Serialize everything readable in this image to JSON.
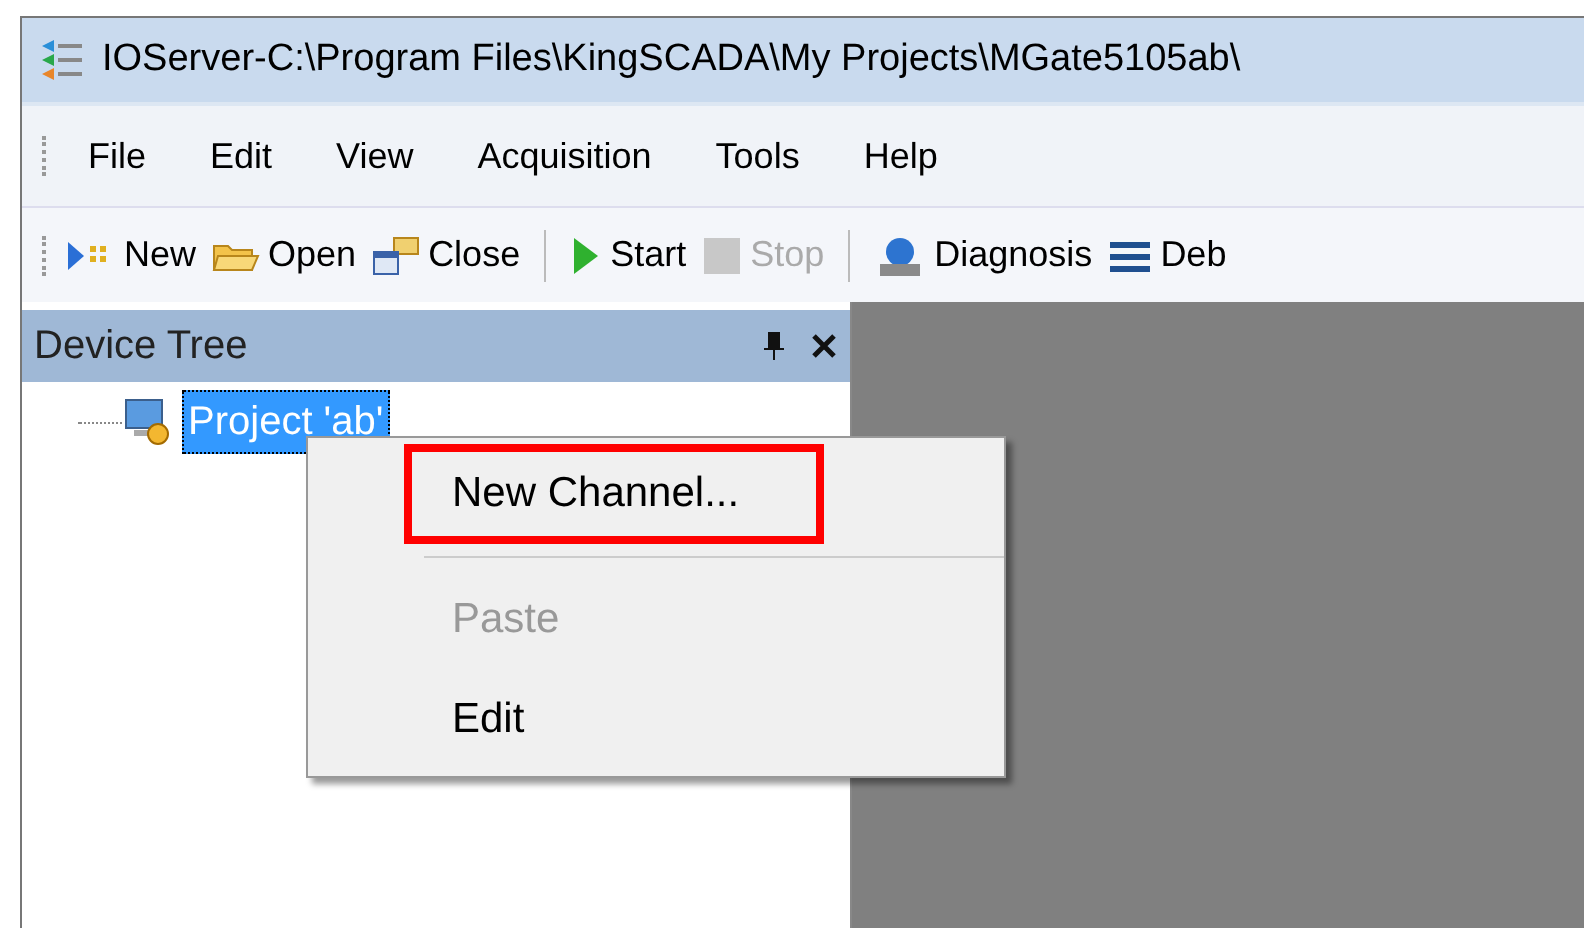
{
  "window": {
    "title": "IOServer-C:\\Program Files\\KingSCADA\\My Projects\\MGate5105ab\\"
  },
  "menu_bar": [
    "File",
    "Edit",
    "View",
    "Acquisition",
    "Tools",
    "Help"
  ],
  "toolbar": [
    {
      "kind": "new",
      "label": "New",
      "disabled": false
    },
    {
      "kind": "open",
      "label": "Open",
      "disabled": false
    },
    {
      "kind": "close",
      "label": "Close",
      "disabled": false
    },
    {
      "kind": "separator"
    },
    {
      "kind": "start",
      "label": "Start",
      "disabled": false
    },
    {
      "kind": "stop",
      "label": "Stop",
      "disabled": true
    },
    {
      "kind": "separator"
    },
    {
      "kind": "diagnosis",
      "label": "Diagnosis",
      "disabled": false
    },
    {
      "kind": "debug",
      "label": "Deb",
      "disabled": false
    }
  ],
  "device_tree": {
    "title": "Device Tree",
    "items": [
      {
        "label": "Project 'ab'",
        "selected": true
      }
    ]
  },
  "context_menu": [
    {
      "label": "New Channel...",
      "disabled": false,
      "highlighted": true
    },
    {
      "kind": "separator"
    },
    {
      "label": "Paste",
      "disabled": true,
      "highlighted": false
    },
    {
      "label": "Edit",
      "disabled": false,
      "highlighted": false
    }
  ]
}
